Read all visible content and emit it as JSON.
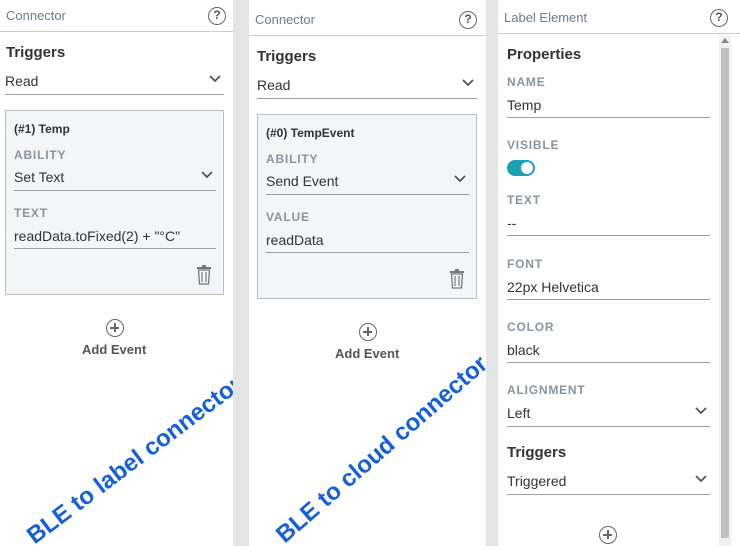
{
  "panel1": {
    "title": "Connector",
    "help_icon": "?",
    "triggers_title": "Triggers",
    "trigger_value": "Read",
    "event": {
      "title": "(#1) Temp",
      "ability_label": "ABILITY",
      "ability_value": "Set Text",
      "text_label": "TEXT",
      "text_value": "readData.toFixed(2) + \"°C\""
    },
    "add_event": "Add Event",
    "annotation": "BLE to label connector"
  },
  "panel2": {
    "title": "Connector",
    "help_icon": "?",
    "triggers_title": "Triggers",
    "trigger_value": "Read",
    "event": {
      "title": "(#0) TempEvent",
      "ability_label": "ABILITY",
      "ability_value": "Send Event",
      "value_label": "VALUE",
      "value_value": "readData"
    },
    "add_event": "Add Event",
    "annotation": "BLE to cloud connector"
  },
  "panel3": {
    "title": "Label Element",
    "help_icon": "?",
    "properties_title": "Properties",
    "name_label": "NAME",
    "name_value": "Temp",
    "visible_label": "VISIBLE",
    "visible_on": true,
    "text_label": "TEXT",
    "text_value": "--",
    "font_label": "FONT",
    "font_value": "22px Helvetica",
    "color_label": "COLOR",
    "color_value": "black",
    "alignment_label": "ALIGNMENT",
    "alignment_value": "Left",
    "triggers_title": "Triggers",
    "trigger_value": "Triggered"
  },
  "colors": {
    "accent": "#1ea0b8",
    "annotation": "#1560d8"
  }
}
